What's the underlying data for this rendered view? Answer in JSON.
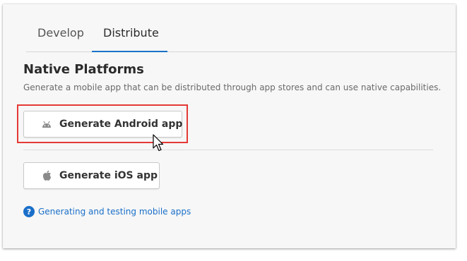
{
  "tabs": [
    {
      "label": "Develop"
    },
    {
      "label": "Distribute"
    }
  ],
  "active_tab": "Distribute",
  "section": {
    "title": "Native Platforms",
    "description": "Generate a mobile app that can be distributed through app stores and can use native capabilities."
  },
  "buttons": {
    "android": {
      "label": "Generate Android app",
      "icon": "android-icon"
    },
    "ios": {
      "label": "Generate iOS app",
      "icon": "apple-icon"
    }
  },
  "help": {
    "icon": "question-circle-icon",
    "link_text": "Generating and testing mobile apps"
  },
  "colors": {
    "accent": "#1a73c8",
    "highlight": "#e53935",
    "link": "#1a6fc9"
  }
}
